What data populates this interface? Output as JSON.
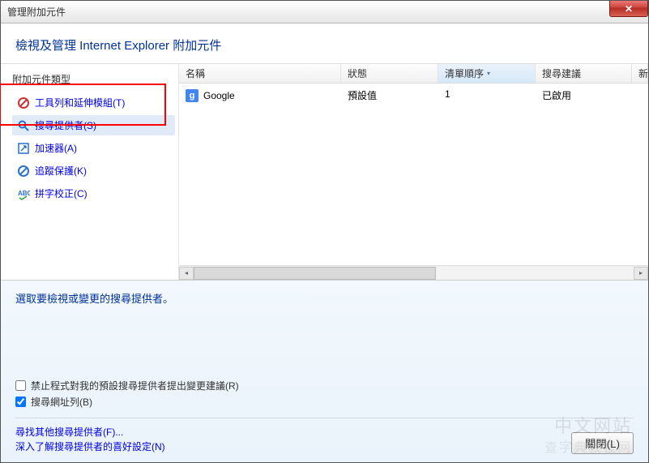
{
  "window": {
    "title": "管理附加元件"
  },
  "header": {
    "title": "檢視及管理 Internet Explorer 附加元件"
  },
  "sidebar": {
    "heading": "附加元件類型",
    "items": [
      {
        "label": "工具列和延伸模組(T)",
        "icon": "gear-blocked-icon",
        "selected": false
      },
      {
        "label": "搜尋提供者(S)",
        "icon": "search-icon",
        "selected": true
      },
      {
        "label": "加速器(A)",
        "icon": "accelerator-icon",
        "selected": false
      },
      {
        "label": "追蹤保護(K)",
        "icon": "shield-icon",
        "selected": false
      },
      {
        "label": "拼字校正(C)",
        "icon": "spellcheck-icon",
        "selected": false
      }
    ]
  },
  "table": {
    "columns": {
      "name": "名稱",
      "status": "狀態",
      "order": "清單順序",
      "suggest": "搜尋建議",
      "extra": "新"
    },
    "rows": [
      {
        "icon": "g",
        "name": "Google",
        "status": "預設值",
        "order": "1",
        "suggest": "已啟用"
      }
    ]
  },
  "lower": {
    "instruction": "選取要檢視或變更的搜尋提供者。",
    "checkboxes": {
      "prevent": {
        "label": "禁止程式對我的預設搜尋提供者提出變更建議(R)",
        "checked": false
      },
      "addressbar": {
        "label": "搜尋網址列(B)",
        "checked": true
      }
    },
    "links": {
      "find": "尋找其他搜尋提供者(F)...",
      "learn": "深入了解搜尋提供者的喜好設定(N)"
    },
    "close_button": "關閉(L)"
  },
  "watermark": {
    "line1": "中文网站",
    "line2": "查字典教程网"
  }
}
